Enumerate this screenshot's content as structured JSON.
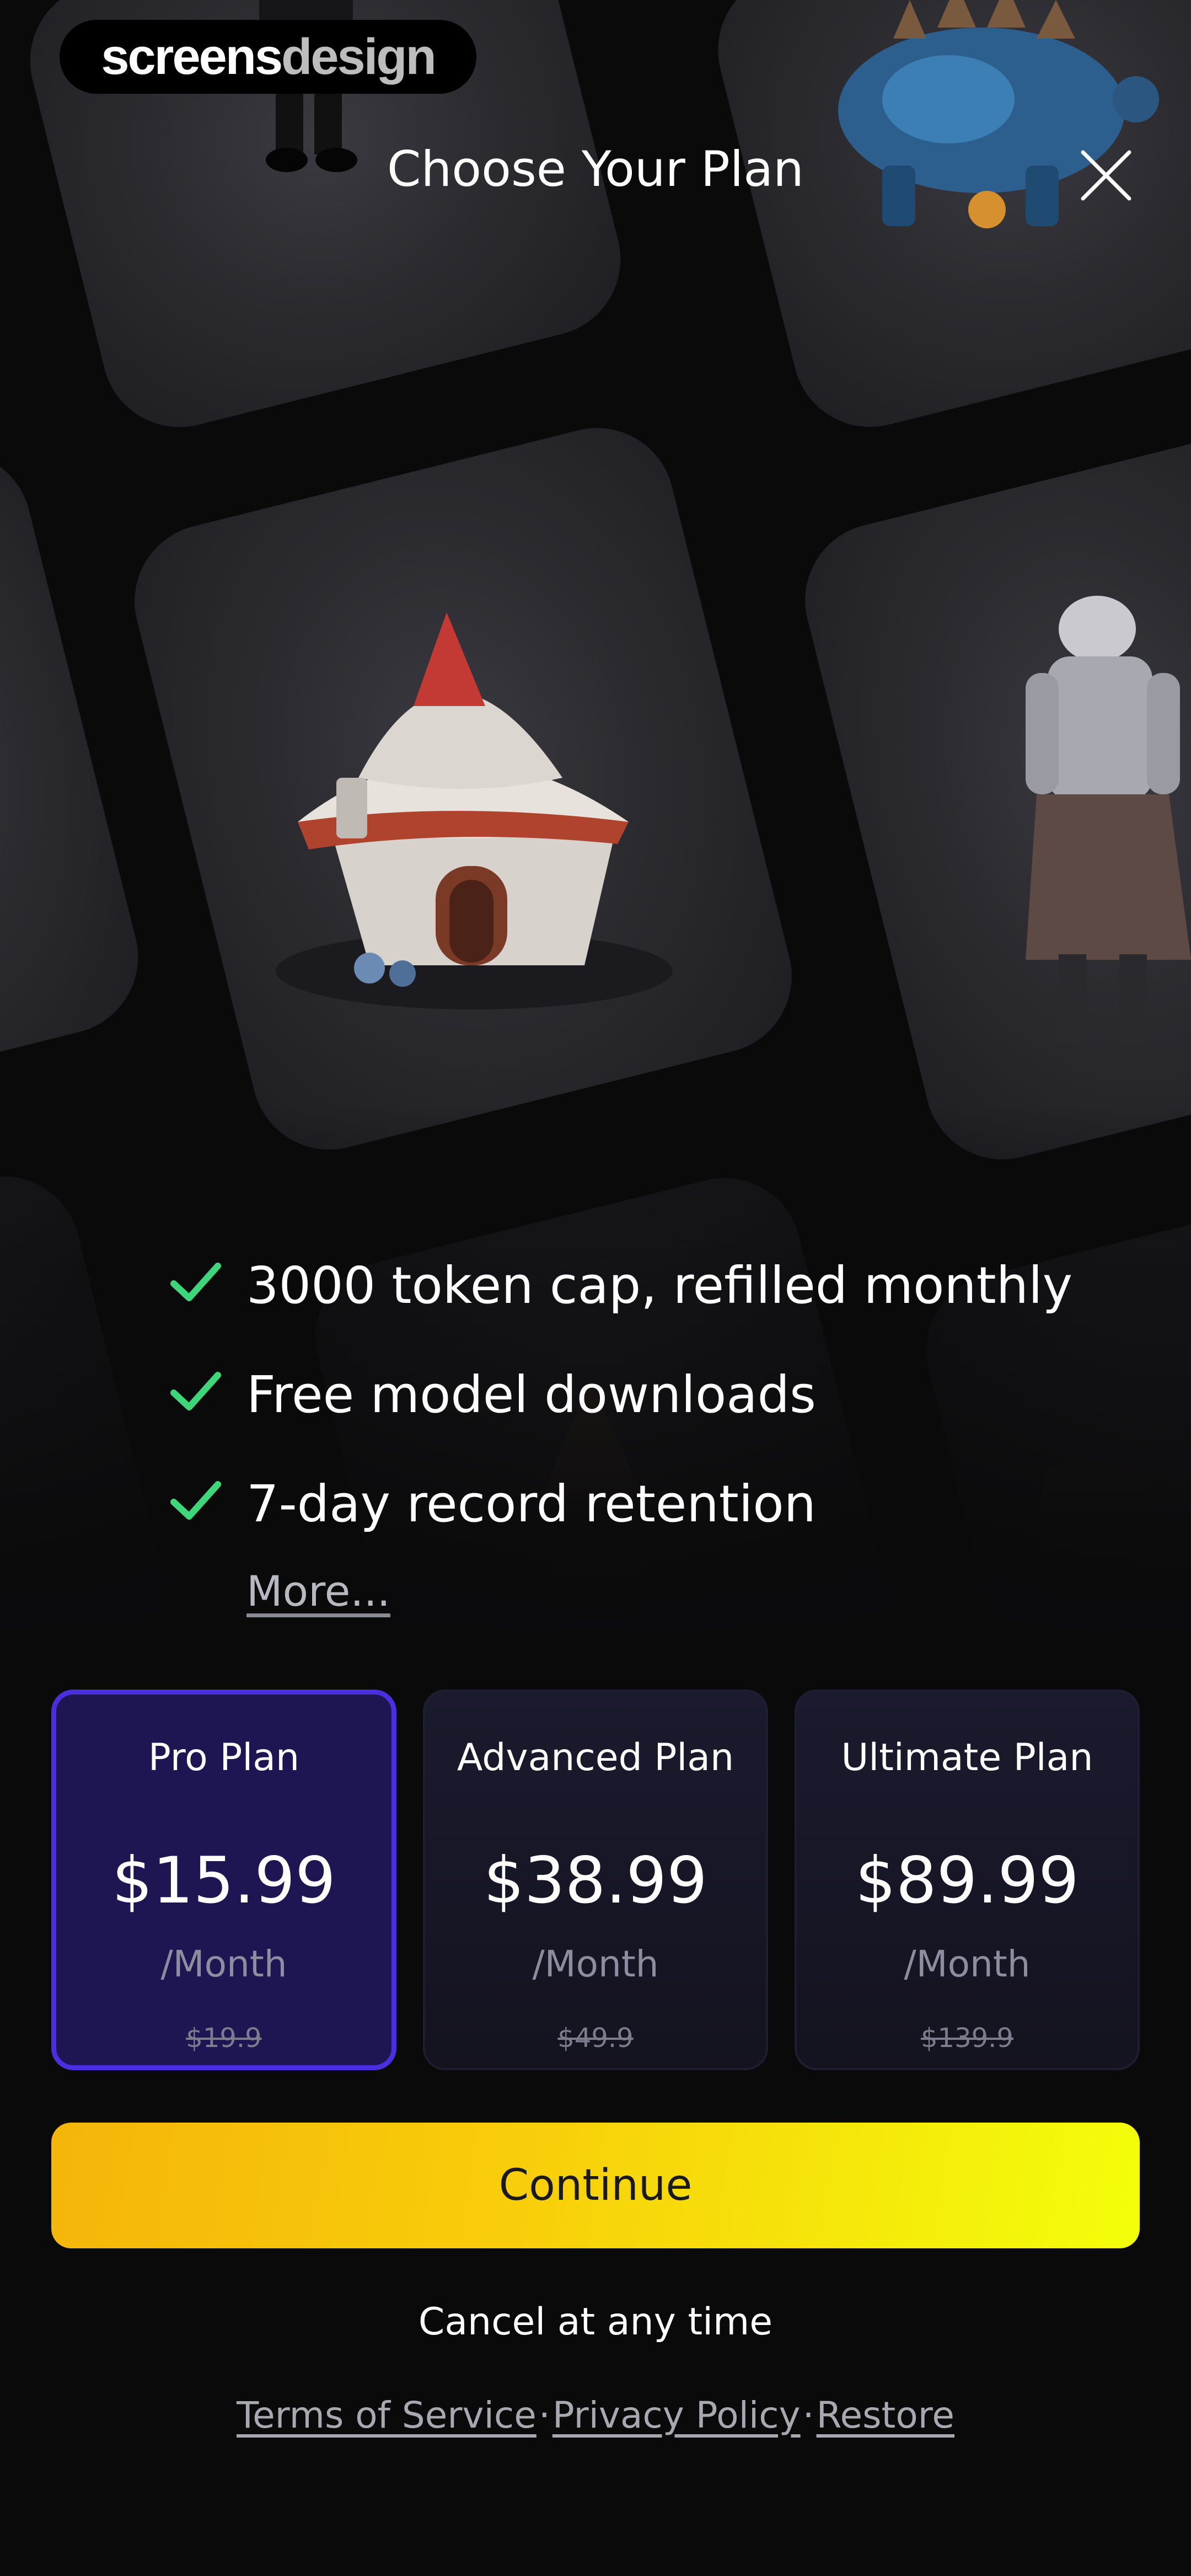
{
  "watermark": {
    "part1": "screens",
    "part2": "design"
  },
  "header": {
    "title": "Choose Your Plan",
    "close_icon": "close-icon"
  },
  "features": [
    {
      "text": "3000 token cap, refilled monthly",
      "icon": "check-icon"
    },
    {
      "text": "Free model downloads",
      "icon": "check-icon"
    },
    {
      "text": "7-day record retention",
      "icon": "check-icon"
    }
  ],
  "more_label": "More...",
  "plans": [
    {
      "name": "Pro Plan",
      "price": "$15.99",
      "period": "/Month",
      "old_price": "$19.9",
      "selected": true
    },
    {
      "name": "Advanced Plan",
      "price": "$38.99",
      "period": "/Month",
      "old_price": "$49.9",
      "selected": false
    },
    {
      "name": "Ultimate Plan",
      "price": "$89.99",
      "period": "/Month",
      "old_price": "$139.9",
      "selected": false
    }
  ],
  "continue_label": "Continue",
  "cancel_text": "Cancel at any time",
  "legal": {
    "terms": "Terms of Service",
    "privacy": "Privacy Policy",
    "restore": "Restore",
    "separator": "·"
  },
  "colors": {
    "accent_selected_border": "#4a2fe0",
    "selected_plan_bg": "#1e1652",
    "check_green": "#3ed67a",
    "continue_gradient_start": "#f5b50a",
    "continue_gradient_end": "#f3ff0a",
    "background": "#0a0a0b"
  }
}
